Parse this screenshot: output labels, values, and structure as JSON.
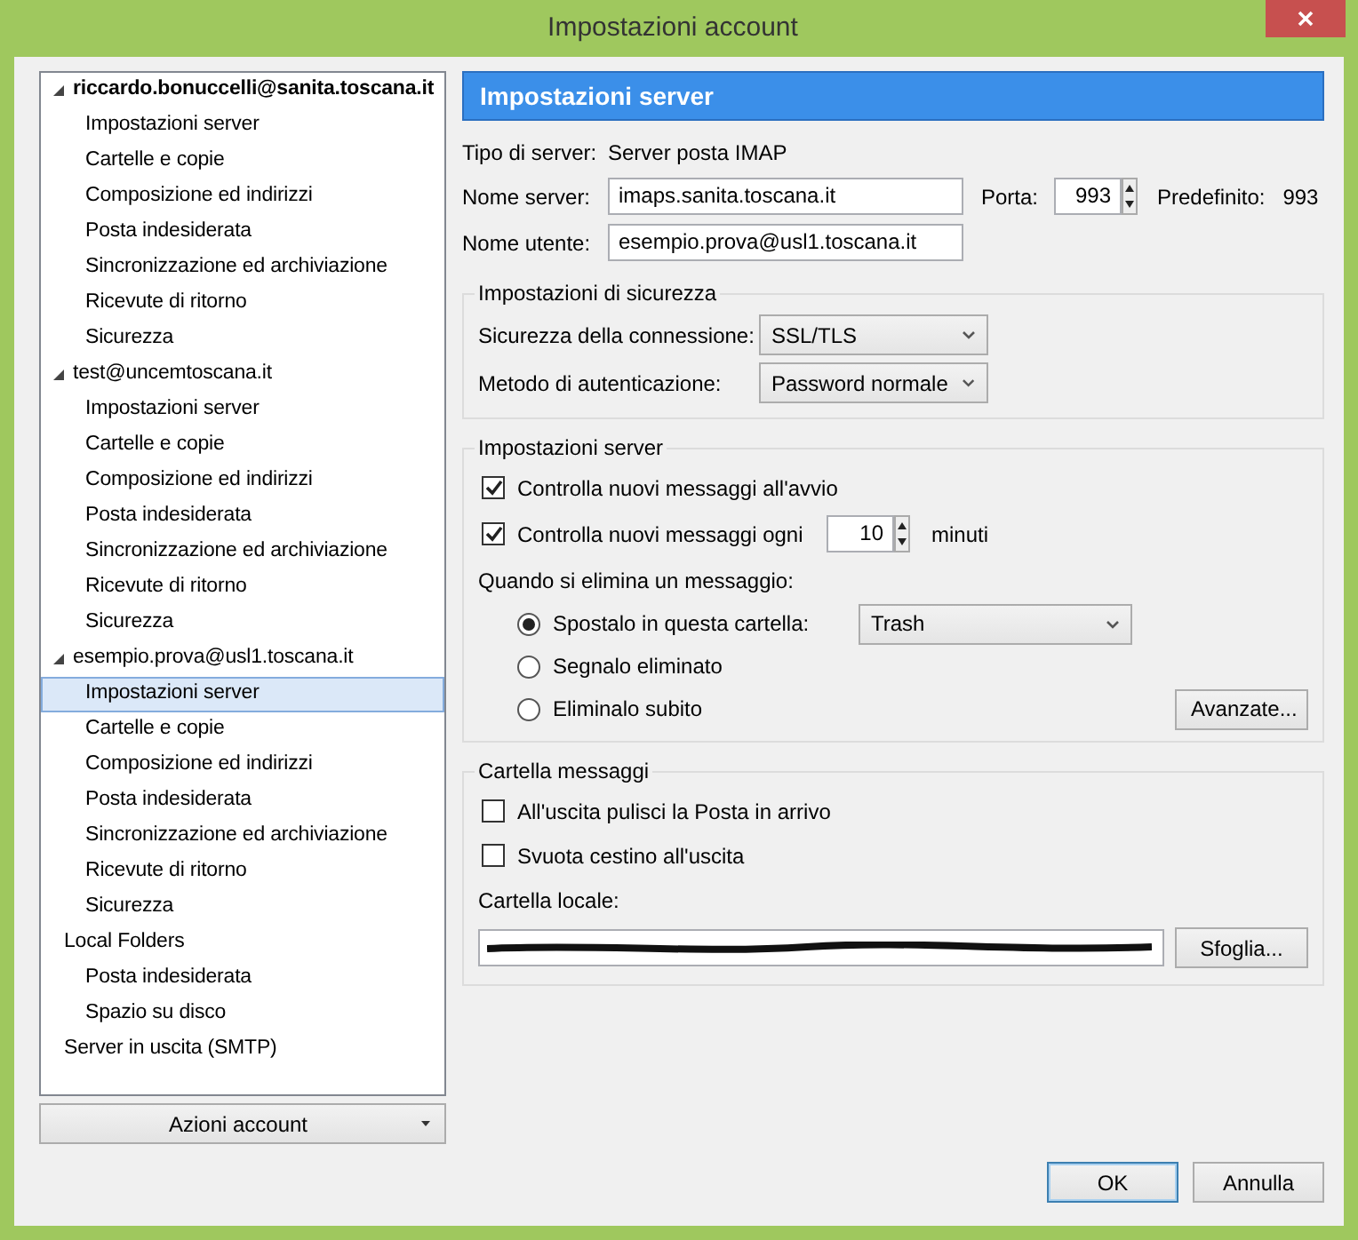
{
  "window": {
    "title": "Impostazioni account"
  },
  "account_tree": {
    "items": [
      {
        "label": "riccardo.bonuccelli@sanita.toscana.it",
        "bold": true,
        "expanded": true,
        "selected": false,
        "children": [
          {
            "label": "Impostazioni server",
            "selected": false
          },
          {
            "label": "Cartelle e copie",
            "selected": false
          },
          {
            "label": "Composizione ed indirizzi",
            "selected": false
          },
          {
            "label": "Posta indesiderata",
            "selected": false
          },
          {
            "label": "Sincronizzazione ed archiviazione",
            "selected": false
          },
          {
            "label": "Ricevute di ritorno",
            "selected": false
          },
          {
            "label": "Sicurezza",
            "selected": false
          }
        ]
      },
      {
        "label": "test@uncemtoscana.it",
        "bold": false,
        "expanded": true,
        "selected": false,
        "children": [
          {
            "label": "Impostazioni server",
            "selected": false
          },
          {
            "label": "Cartelle e copie",
            "selected": false
          },
          {
            "label": "Composizione ed indirizzi",
            "selected": false
          },
          {
            "label": "Posta indesiderata",
            "selected": false
          },
          {
            "label": "Sincronizzazione ed archiviazione",
            "selected": false
          },
          {
            "label": "Ricevute di ritorno",
            "selected": false
          },
          {
            "label": "Sicurezza",
            "selected": false
          }
        ]
      },
      {
        "label": "esempio.prova@usl1.toscana.it",
        "bold": false,
        "expanded": true,
        "selected": false,
        "children": [
          {
            "label": "Impostazioni server",
            "selected": true
          },
          {
            "label": "Cartelle e copie",
            "selected": false
          },
          {
            "label": "Composizione ed indirizzi",
            "selected": false
          },
          {
            "label": "Posta indesiderata",
            "selected": false
          },
          {
            "label": "Sincronizzazione ed archiviazione",
            "selected": false
          },
          {
            "label": "Ricevute di ritorno",
            "selected": false
          },
          {
            "label": "Sicurezza",
            "selected": false
          }
        ]
      },
      {
        "label": "Local Folders",
        "bold": false,
        "selected": false,
        "children": [
          {
            "label": "Posta indesiderata",
            "selected": false
          },
          {
            "label": "Spazio su disco",
            "selected": false
          }
        ]
      },
      {
        "label": "Server in uscita (SMTP)",
        "bold": false,
        "selected": false
      }
    ],
    "actions_button": "Azioni account"
  },
  "panel": {
    "title": "Impostazioni server",
    "server_type": {
      "label": "Tipo di server:",
      "value": "Server posta IMAP"
    },
    "server_name": {
      "label": "Nome server:",
      "value": "imaps.sanita.toscana.it"
    },
    "port": {
      "label": "Porta:",
      "value": "993"
    },
    "default_port": {
      "label": "Predefinito:",
      "value": "993"
    },
    "user_name": {
      "label": "Nome utente:",
      "value": "esempio.prova@usl1.toscana.it"
    },
    "groups": [
      {
        "title": "Impostazioni di sicurezza",
        "rows": [
          {
            "kind": "select",
            "label": "Sicurezza della connessione:",
            "value": "SSL/TLS"
          },
          {
            "kind": "select",
            "label": "Metodo di autenticazione:",
            "value": "Password normale"
          }
        ]
      },
      {
        "title": "Impostazioni server",
        "rows": [
          {
            "kind": "checkbox",
            "label": "Controlla nuovi messaggi all'avvio",
            "checked": true
          },
          {
            "kind": "interval",
            "label": "Controlla nuovi messaggi ogni",
            "checked": true,
            "value": "10",
            "unit": "minuti"
          },
          {
            "kind": "text",
            "label": "Quando si elimina un messaggio:"
          },
          {
            "kind": "radio",
            "label": "Spostalo in questa cartella:",
            "selected": true,
            "select": "Trash"
          },
          {
            "kind": "radio",
            "label": "Segnalo eliminato",
            "selected": false
          },
          {
            "kind": "radio",
            "label": "Eliminalo subito",
            "selected": false,
            "button": "Avanzate..."
          }
        ]
      },
      {
        "title": "Cartella messaggi",
        "rows": [
          {
            "kind": "checkbox",
            "label": "All'uscita pulisci la Posta in arrivo",
            "checked": false
          },
          {
            "kind": "checkbox",
            "label": "Svuota cestino all'uscita",
            "checked": false
          },
          {
            "kind": "text",
            "label": "Cartella locale:"
          },
          {
            "kind": "path",
            "redacted": true,
            "button": "Sfoglia..."
          }
        ]
      }
    ]
  },
  "buttons": [
    {
      "label": "OK",
      "default": true
    },
    {
      "label": "Annulla",
      "default": false
    }
  ]
}
